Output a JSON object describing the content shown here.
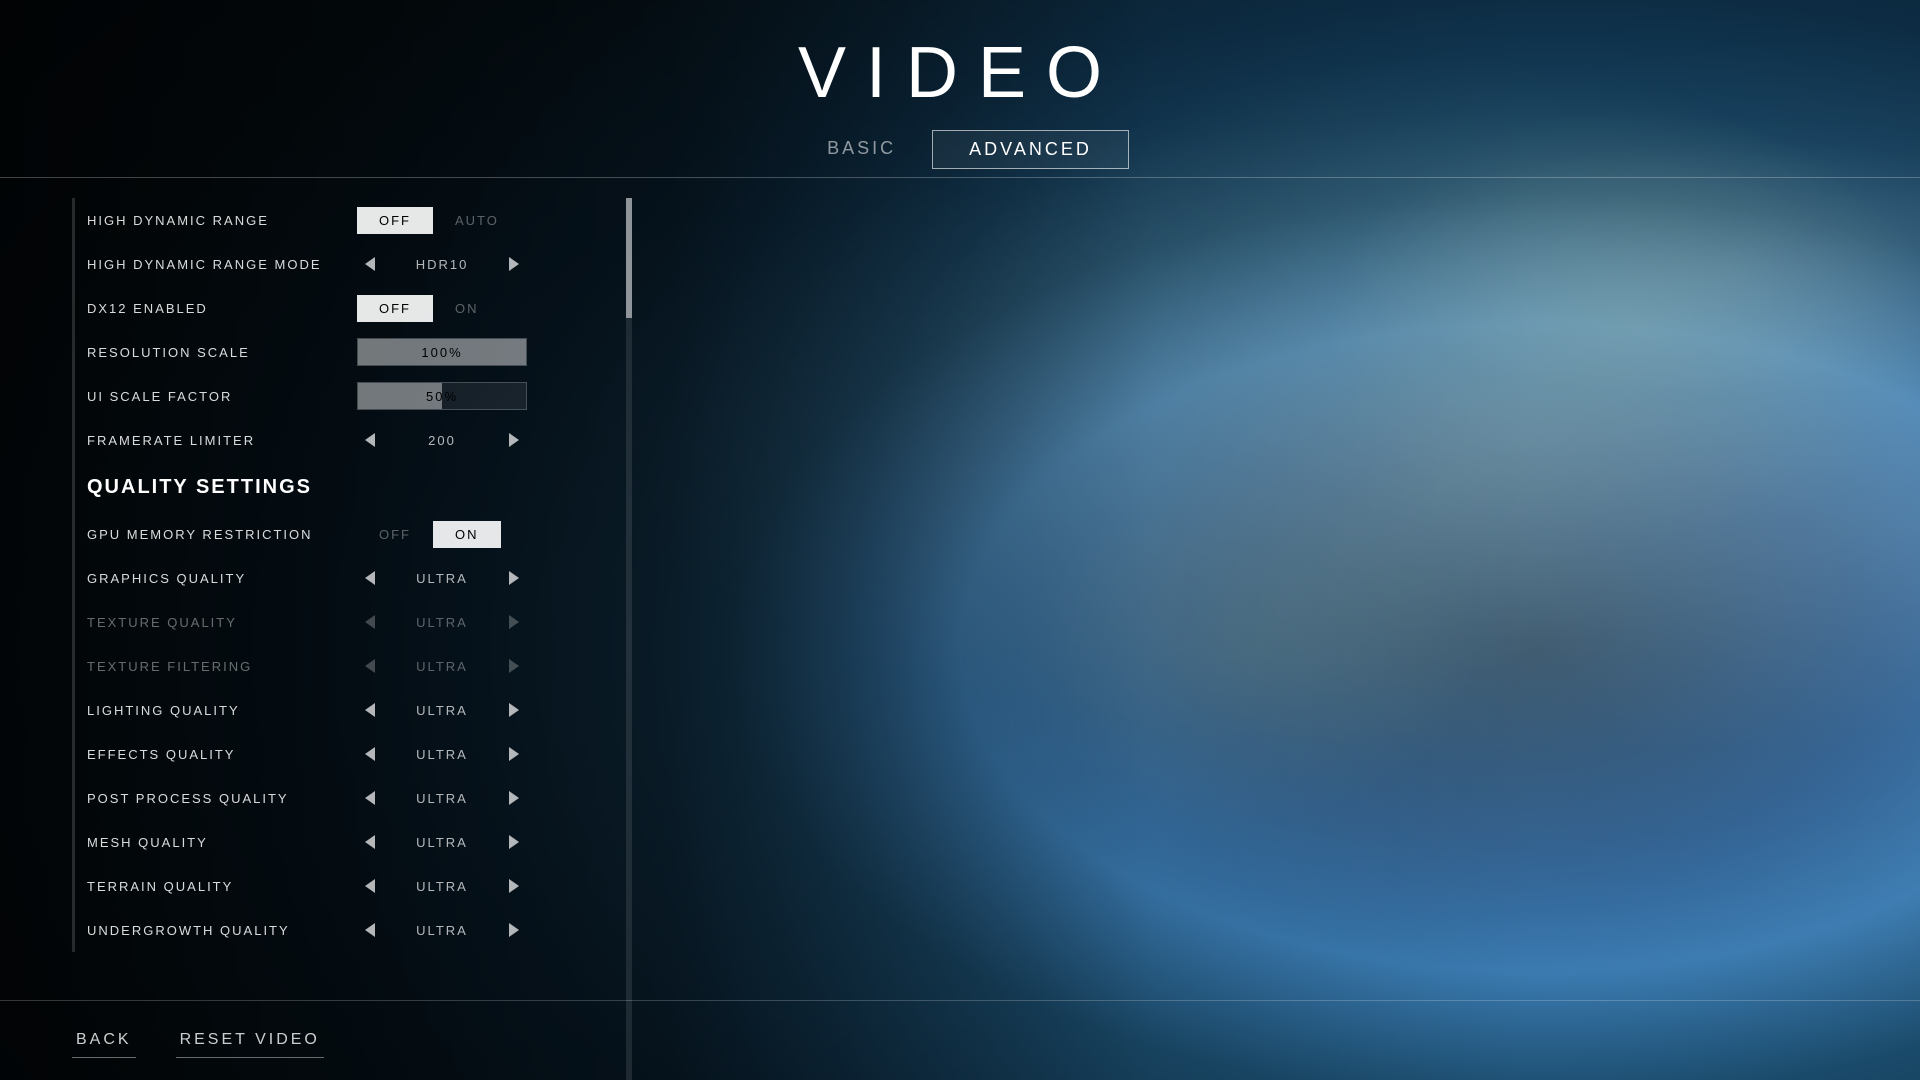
{
  "page": {
    "title": "VIDEO",
    "tabs": [
      {
        "id": "basic",
        "label": "BASIC",
        "active": false
      },
      {
        "id": "advanced",
        "label": "ADVANCED",
        "active": true
      }
    ]
  },
  "settings": {
    "items": [
      {
        "id": "high-dynamic-range",
        "label": "HIGH DYNAMIC RANGE",
        "type": "toggle",
        "value": "OFF",
        "options": [
          "OFF",
          "AUTO"
        ],
        "active_index": 0
      },
      {
        "id": "high-dynamic-range-mode",
        "label": "HIGH DYNAMIC RANGE MODE",
        "type": "arrow-selector",
        "value": "HDR10"
      },
      {
        "id": "dx12-enabled",
        "label": "DX12 ENABLED",
        "type": "toggle",
        "value": "OFF",
        "options": [
          "OFF",
          "ON"
        ],
        "active_index": 0
      },
      {
        "id": "resolution-scale",
        "label": "RESOLUTION SCALE",
        "type": "slider",
        "value": "100%",
        "fill_percent": 100
      },
      {
        "id": "ui-scale-factor",
        "label": "UI SCALE FACTOR",
        "type": "slider",
        "value": "50%",
        "fill_percent": 50
      },
      {
        "id": "framerate-limiter",
        "label": "FRAMERATE LIMITER",
        "type": "arrow-selector",
        "value": "200"
      },
      {
        "id": "quality-settings-header",
        "label": "QUALITY SETTINGS",
        "type": "section-header"
      },
      {
        "id": "gpu-memory-restriction",
        "label": "GPU MEMORY RESTRICTION",
        "type": "toggle",
        "value": "ON",
        "options": [
          "OFF",
          "ON"
        ],
        "active_index": 1
      },
      {
        "id": "graphics-quality",
        "label": "GRAPHICS QUALITY",
        "type": "arrow-selector",
        "value": "ULTRA",
        "dimmed": false
      },
      {
        "id": "texture-quality",
        "label": "TEXTURE QUALITY",
        "type": "arrow-selector",
        "value": "ULTRA",
        "dimmed": true
      },
      {
        "id": "texture-filtering",
        "label": "TEXTURE FILTERING",
        "type": "arrow-selector",
        "value": "ULTRA",
        "dimmed": true
      },
      {
        "id": "lighting-quality",
        "label": "LIGHTING QUALITY",
        "type": "arrow-selector",
        "value": "ULTRA",
        "dimmed": false
      },
      {
        "id": "effects-quality",
        "label": "EFFECTS QUALITY",
        "type": "arrow-selector",
        "value": "ULTRA",
        "dimmed": false
      },
      {
        "id": "post-process-quality",
        "label": "POST PROCESS QUALITY",
        "type": "arrow-selector",
        "value": "ULTRA",
        "dimmed": false
      },
      {
        "id": "mesh-quality",
        "label": "MESH QUALITY",
        "type": "arrow-selector",
        "value": "ULTRA",
        "dimmed": false
      },
      {
        "id": "terrain-quality",
        "label": "TERRAIN QUALITY",
        "type": "arrow-selector",
        "value": "ULTRA",
        "dimmed": false
      },
      {
        "id": "undergrowth-quality",
        "label": "UNDERGROWTH QUALITY",
        "type": "arrow-selector",
        "value": "ULTRA",
        "dimmed": false
      }
    ]
  },
  "footer": {
    "back_label": "BACK",
    "reset_label": "RESET VIDEO"
  }
}
